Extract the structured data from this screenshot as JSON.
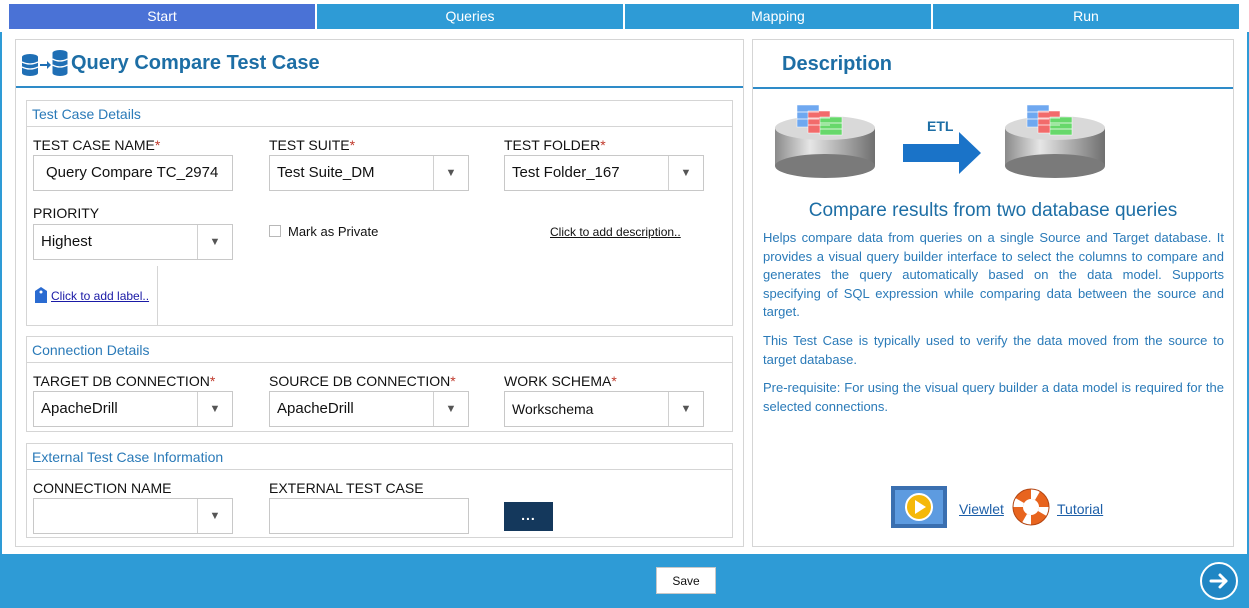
{
  "tabs": [
    {
      "label": "Start",
      "active": true
    },
    {
      "label": "Queries",
      "active": false
    },
    {
      "label": "Mapping",
      "active": false
    },
    {
      "label": "Run",
      "active": false
    }
  ],
  "left_panel": {
    "title": "Query Compare Test Case",
    "icon": "database-compare-icon",
    "test_case_details": {
      "title": "Test Case Details",
      "test_case_name": {
        "label": "TEST CASE NAME",
        "required_mark": "*",
        "value": "Query Compare TC_2974"
      },
      "test_suite": {
        "label": "TEST SUITE",
        "required_mark": "*",
        "value": "Test Suite_DM"
      },
      "test_folder": {
        "label": "TEST FOLDER",
        "required_mark": "*",
        "value": "Test Folder_167"
      },
      "priority": {
        "label": "PRIORITY",
        "value": "Highest"
      },
      "mark_private": {
        "label": "Mark as Private",
        "checked": false
      },
      "add_description": "Click to add description..",
      "add_label": "Click to add label.."
    },
    "connection_details": {
      "title": "Connection Details",
      "target_db": {
        "label": "TARGET DB CONNECTION",
        "required_mark": "*",
        "value": "ApacheDrill"
      },
      "source_db": {
        "label": "SOURCE DB CONNECTION",
        "required_mark": "*",
        "value": "ApacheDrill"
      },
      "work_schema": {
        "label": "WORK SCHEMA",
        "required_mark": "*",
        "value": "Workschema"
      }
    },
    "external_info": {
      "title": "External Test Case Information",
      "connection_name": {
        "label": "CONNECTION NAME",
        "value": ""
      },
      "external_test_case": {
        "label": "EXTERNAL TEST CASE",
        "value": ""
      },
      "browse_label": "..."
    }
  },
  "description": {
    "title": "Description",
    "etl_label": "ETL",
    "heading": "Compare results from two database queries",
    "paragraphs": [
      "Helps compare data from queries on a single Source and Target database. It provides a visual query builder interface to select the columns to compare and generates the query automatically based on the data model. Supports specifying of SQL expression while comparing data between the source and target.",
      "This Test Case is typically used to verify the data moved from the source to target database.",
      "Pre-requisite: For using the visual query builder a data model is required for the selected connections."
    ],
    "viewlet_label": "Viewlet",
    "tutorial_label": "Tutorial"
  },
  "footer": {
    "save_label": "Save",
    "next_icon": "arrow-right-circle-icon"
  },
  "colors": {
    "accent": "#2e9bd6",
    "active_tab": "#4a72d6",
    "title_blue": "#1d6ea5",
    "required": "#c0392b",
    "dark_button": "#14385c"
  }
}
